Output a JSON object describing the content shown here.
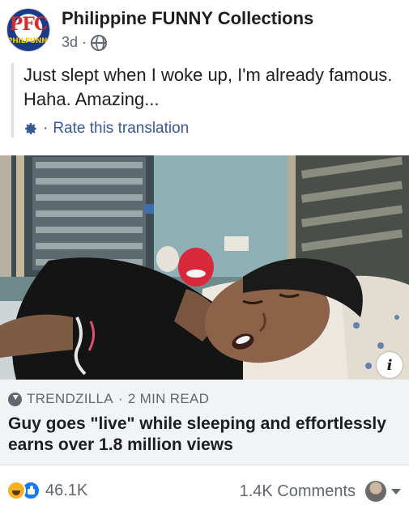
{
  "post": {
    "page_name": "Philippine FUNNY Collections",
    "time": "3d",
    "separator": "·",
    "avatar_text": "PFC",
    "avatar_ring_text": "PHILFUNNY",
    "translated_text": "Just slept when I woke up, I'm already famous. Haha. Amazing...",
    "rate_translation": "Rate this translation",
    "icons": {
      "audience": "globe-icon",
      "settings": "gear-icon"
    }
  },
  "link": {
    "source": "TRENDZILLA",
    "separator": "·",
    "read_time": "2 MIN READ",
    "headline": "Guy goes \"live\" while sleeping and effortlessly earns over 1.8 million views",
    "info_glyph": "i"
  },
  "footer": {
    "reaction_count": "46.1K",
    "comments": "1.4K Comments",
    "reaction_icons": [
      "haha-icon",
      "like-icon"
    ]
  },
  "colors": {
    "link_blue": "#385898",
    "secondary_text": "#606770",
    "link_box_bg": "#f2f3f5",
    "like_blue": "#1877f2",
    "haha_yellow": "#f7b125"
  }
}
